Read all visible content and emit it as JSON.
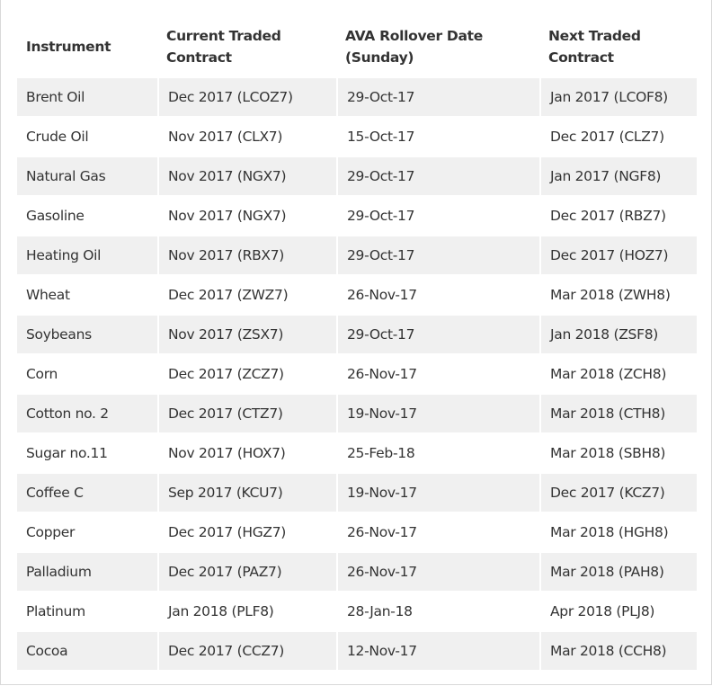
{
  "table": {
    "headers": [
      "Instrument",
      "Current Traded\nContract",
      "AVA Rollover Date\n(Sunday)",
      "Next Traded\nContract"
    ],
    "header_lines": [
      [
        "Instrument"
      ],
      [
        "Current Traded",
        "Contract"
      ],
      [
        "AVA Rollover Date",
        "(Sunday)"
      ],
      [
        "Next Traded",
        "Contract"
      ]
    ],
    "rows": [
      [
        "Brent Oil",
        "Dec 2017 (LCOZ7)",
        "29-Oct-17",
        "Jan 2017 (LCOF8)"
      ],
      [
        "Crude Oil",
        "Nov 2017 (CLX7)",
        "15-Oct-17",
        "Dec 2017 (CLZ7)"
      ],
      [
        "Natural Gas",
        "Nov 2017 (NGX7)",
        "29-Oct-17",
        "Jan 2017 (NGF8)"
      ],
      [
        "Gasoline",
        "Nov 2017 (NGX7)",
        "29-Oct-17",
        "Dec 2017 (RBZ7)"
      ],
      [
        "Heating Oil",
        "Nov 2017 (RBX7)",
        "29-Oct-17",
        "Dec 2017 (HOZ7)"
      ],
      [
        "Wheat",
        "Dec 2017 (ZWZ7)",
        "26-Nov-17",
        "Mar 2018 (ZWH8)"
      ],
      [
        "Soybeans",
        "Nov 2017 (ZSX7)",
        "29-Oct-17",
        "Jan 2018 (ZSF8)"
      ],
      [
        "Corn",
        "Dec 2017 (ZCZ7)",
        "26-Nov-17",
        "Mar 2018 (ZCH8)"
      ],
      [
        "Cotton no. 2",
        "Dec 2017 (CTZ7)",
        "19-Nov-17",
        "Mar 2018 (CTH8)"
      ],
      [
        "Sugar no.11",
        "Nov 2017 (HOX7)",
        "25-Feb-18",
        "Mar 2018 (SBH8)"
      ],
      [
        "Coffee C",
        "Sep 2017 (KCU7)",
        "19-Nov-17",
        "Dec 2017 (KCZ7)"
      ],
      [
        "Copper",
        "Dec 2017 (HGZ7)",
        "26-Nov-17",
        "Mar 2018 (HGH8)"
      ],
      [
        "Palladium",
        "Dec 2017 (PAZ7)",
        "26-Nov-17",
        "Mar 2018 (PAH8)"
      ],
      [
        "Platinum",
        "Jan 2018 (PLF8)",
        "28-Jan-18",
        "Apr 2018 (PLJ8)"
      ],
      [
        "Cocoa",
        "Dec 2017 (CCZ7)",
        "12-Nov-17",
        "Mar 2018 (CCH8)"
      ]
    ]
  },
  "colors": {
    "stripe": "#f0f0f0",
    "text": "#333333",
    "border": "#d9d9d9"
  }
}
